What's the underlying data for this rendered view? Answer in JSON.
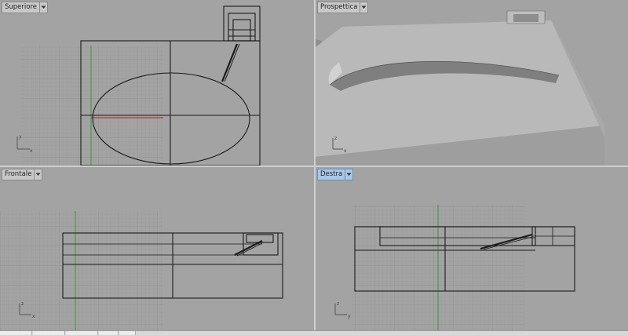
{
  "viewports": {
    "top": {
      "label": "Superiore"
    },
    "perspective": {
      "label": "Prospettica"
    },
    "front": {
      "label": "Frontale"
    },
    "right": {
      "label": "Destra"
    }
  },
  "axes": {
    "top": {
      "v": "y",
      "h": "x"
    },
    "persp": {
      "v": "z",
      "h": "x"
    },
    "front": {
      "v": "z",
      "h": "x"
    },
    "right": {
      "v": "z",
      "h": "y"
    }
  },
  "colors": {
    "viewport_bg": "#a3a3a3",
    "grid_major": "#8f8f8f",
    "grid_minor": "#999999",
    "x_axis": "#b04a4a",
    "y_axis": "#3a9a3a",
    "active_tab": "#a9c7e8"
  },
  "icons": {
    "dropdown": "chevron-down-icon",
    "axes": "axes-gizmo-icon"
  }
}
